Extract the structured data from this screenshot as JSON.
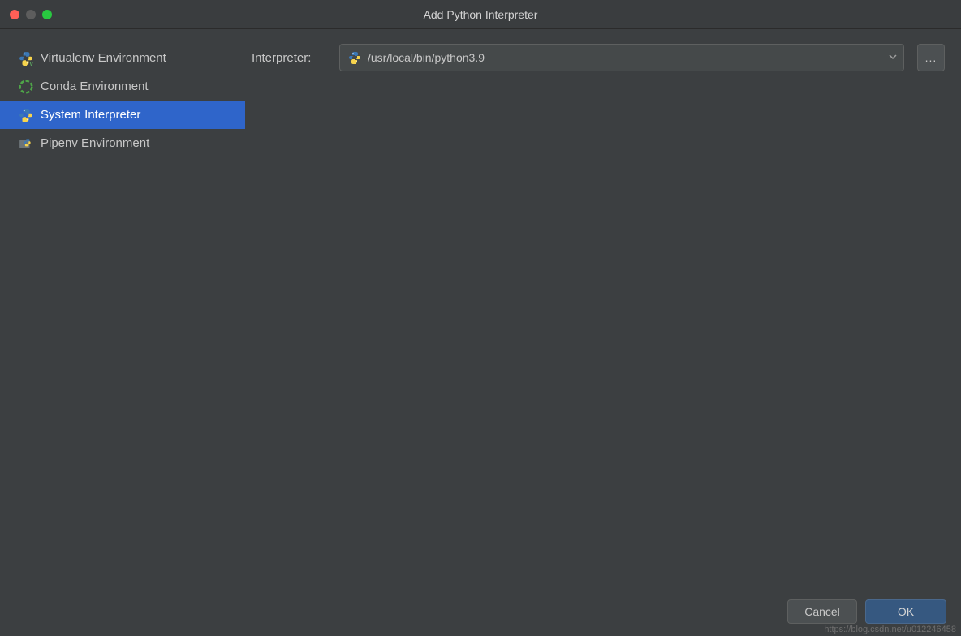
{
  "window": {
    "title": "Add Python Interpreter"
  },
  "sidebar": {
    "items": [
      {
        "label": "Virtualenv Environment",
        "icon": "python-venv",
        "selected": false
      },
      {
        "label": "Conda Environment",
        "icon": "conda",
        "selected": false
      },
      {
        "label": "System Interpreter",
        "icon": "python",
        "selected": true
      },
      {
        "label": "Pipenv Environment",
        "icon": "pipenv",
        "selected": false
      }
    ]
  },
  "form": {
    "interpreter_label": "Interpreter:",
    "interpreter_path": "/usr/local/bin/python3.9",
    "browse_label": "..."
  },
  "buttons": {
    "cancel": "Cancel",
    "ok": "OK"
  },
  "watermark": "https://blog.csdn.net/u012246458"
}
